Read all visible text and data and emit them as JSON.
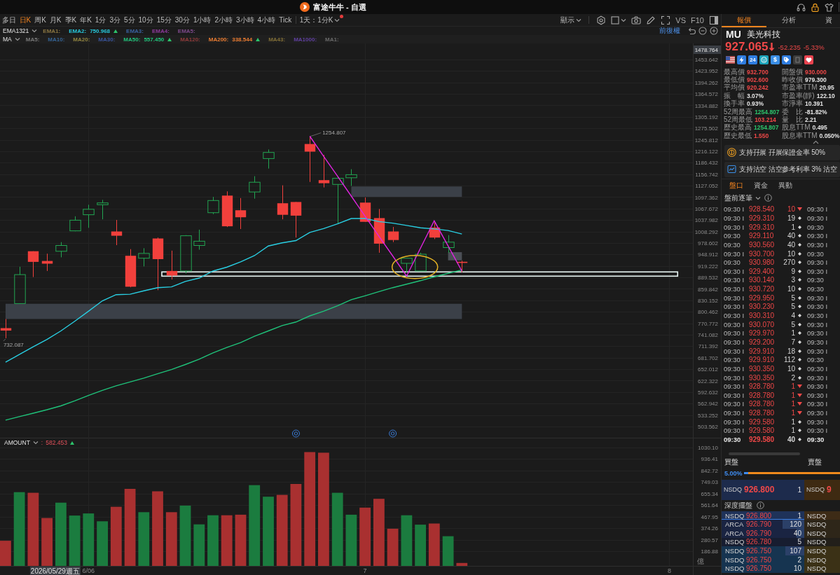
{
  "window": {
    "title": "富途牛牛 - 自選"
  },
  "toolbar": {
    "periods": [
      {
        "label": "多日",
        "selected": false
      },
      {
        "label": "日K",
        "selected": true
      },
      {
        "label": "周K",
        "selected": false
      },
      {
        "label": "月K",
        "selected": false
      },
      {
        "label": "季K",
        "selected": false
      },
      {
        "label": "年K",
        "selected": false
      },
      {
        "label": "1分",
        "selected": false
      },
      {
        "label": "3分",
        "selected": false
      },
      {
        "label": "5分",
        "selected": false
      },
      {
        "label": "10分",
        "selected": false
      },
      {
        "label": "15分",
        "selected": false
      },
      {
        "label": "30分",
        "selected": false
      },
      {
        "label": "1小時",
        "selected": false
      },
      {
        "label": "2小時",
        "selected": false
      },
      {
        "label": "3小時",
        "selected": false
      },
      {
        "label": "4小時",
        "selected": false
      },
      {
        "label": "Tick",
        "selected": false
      }
    ],
    "range": {
      "label": "1天：1分K",
      "alert": true
    },
    "display": "顯示",
    "buttons": [
      "VS",
      "F10"
    ]
  },
  "legend": {
    "rows": [
      {
        "label": "EMA1321",
        "items": [
          {
            "label": "EMA1:",
            "color": "#8a7642",
            "rising": false
          },
          {
            "label": "EMA2:",
            "color": "#27c8dc",
            "value": "750.968",
            "rising": true
          },
          {
            "label": "EMA3:",
            "color": "#3a62a0",
            "rising": false
          },
          {
            "label": "EMA4:",
            "color": "#8e3a9c",
            "rising": false
          },
          {
            "label": "EMA5:",
            "color": "#7e4a8c",
            "rising": false
          }
        ]
      },
      {
        "label": "MA",
        "items": [
          {
            "label": "MA5:",
            "color": "#7a7a7a",
            "rising": false
          },
          {
            "label": "MA10:",
            "color": "#356496",
            "rising": false
          },
          {
            "label": "MA20:",
            "color": "#918540",
            "rising": false
          },
          {
            "label": "MA30:",
            "color": "#3a56a0",
            "rising": false
          },
          {
            "label": "MA50:",
            "color": "#22c47c",
            "value": "557.450",
            "rising": true
          },
          {
            "label": "MA120:",
            "color": "#923c3c",
            "rising": false
          },
          {
            "label": "MA200:",
            "color": "#ec7d32",
            "value": "338.544",
            "rising": true
          },
          {
            "label": "MA43:",
            "color": "#837038",
            "rising": false
          },
          {
            "label": "MA1000:",
            "color": "#6040a0",
            "rising": false
          },
          {
            "label": "MA1:",
            "color": "#6a6a6a",
            "rising": false
          }
        ]
      }
    ],
    "adjustment": "前復權"
  },
  "chart": {
    "crosshair_price": "1478.764",
    "crosshair_date": "2026/05/29週五",
    "volume_header": {
      "label": "AMOUNT",
      "separator": ":",
      "value": "582.453",
      "rising": true
    },
    "chart_data": [
      {
        "type": "candlestick",
        "ylim": [
          474.5,
          1495.34
        ],
        "yticks": [
          1453.642,
          1423.952,
          1394.262,
          1364.572,
          1334.882,
          1305.192,
          1275.502,
          1245.812,
          1216.122,
          1186.432,
          1156.742,
          1127.052,
          1097.362,
          1067.672,
          1037.982,
          1008.292,
          978.602,
          948.912,
          919.222,
          889.532,
          859.842,
          830.152,
          800.462,
          770.772,
          741.082,
          711.392,
          681.702,
          652.012,
          622.322,
          592.632,
          562.942,
          533.252,
          503.562
        ],
        "tick_labels": "y",
        "grid": true,
        "ohlc": [
          [
            758.3,
            781.9,
            732.087,
            752.0
          ],
          [
            822.0,
            917.2,
            821.0,
            896.8
          ],
          [
            957.3,
            957.3,
            890.5,
            929.8
          ],
          [
            932.2,
            951.0,
            906.2,
            925.1
          ],
          [
            957.3,
            980.9,
            941.6,
            972.3
          ],
          [
            1010.0,
            1047.8,
            1009.0,
            1037.6
          ],
          [
            1051.7,
            1077.7,
            1017.9,
            1065.9
          ],
          [
            1077.7,
            1090.3,
            1039.9,
            1082.4
          ],
          [
            1008.5,
            1038.4,
            973.1,
            997.4
          ],
          [
            945.5,
            962.8,
            864.0,
            865.3
          ],
          [
            939.2,
            965.2,
            918.0,
            951.8
          ],
          [
            990.4,
            992.7,
            856.6,
            936.9
          ],
          [
            906.2,
            958.9,
            884.2,
            894.4
          ],
          [
            906.2,
            999.0,
            899.9,
            997.4
          ],
          [
            972.3,
            1013.2,
            961.3,
            983.3
          ],
          [
            1057.2,
            1098.1,
            1053.3,
            1088.7
          ],
          [
            1101.3,
            1112.3,
            1020.0,
            1021.8
          ],
          [
            1063.5,
            1095.0,
            1014.8,
            1045.4
          ],
          [
            1110.7,
            1151.6,
            1093.4,
            1135.9
          ],
          [
            1197.2,
            1220.8,
            1171.3,
            1213.0
          ],
          [
            1081.6,
            1128.0,
            1039.9,
            1051.7
          ],
          [
            1084.8,
            1084.8,
            992.7,
            1049.4
          ],
          [
            1235.0,
            1254.807,
            1136.7,
            1215.3
          ],
          [
            1141.4,
            1206.7,
            1122.5,
            1133.5
          ],
          [
            1130.4,
            1150.0,
            1028.1,
            1146.1
          ],
          [
            1147.7,
            1169.7,
            1126.5,
            1155.6
          ],
          [
            1083.2,
            1096.6,
            1033.6,
            1033.6
          ],
          [
            1043.1,
            1066.7,
            953.4,
            977.0
          ],
          [
            1008.5,
            1020.3,
            980.9,
            986.4
          ],
          [
            925.9,
            939.2,
            902.3,
            939.2
          ],
          [
            906.2,
            953.4,
            906.2,
            949.5
          ],
          [
            1018.7,
            1032.1,
            988.8,
            992.7
          ],
          [
            966.8,
            999.0,
            953.4,
            980.9
          ],
          [
            930.0,
            932.7,
            902.6,
            927.065
          ]
        ],
        "series": [
          {
            "type": "line",
            "color": "#29cfe3",
            "values": [
              670,
              690,
              710,
              729,
              751,
              776,
              802,
              829,
              845,
              846,
              855,
              863,
              865,
              879,
              888,
              906,
              916,
              930,
              946,
              971,
              979,
              985,
              1006,
              1016,
              1028,
              1042,
              1042,
              1034,
              1030,
              1024,
              1018,
              1015,
              1011,
              1002
            ]
          },
          {
            "type": "line",
            "color": "#1fc27a",
            "values": [
              520,
              529,
              538,
              547,
              557,
              570,
              584,
              597,
              609,
              619,
              629,
              640,
              651,
              664,
              678,
              694,
              708,
              721,
              737,
              751,
              765,
              774,
              790,
              802,
              816,
              832,
              842,
              853,
              863,
              872,
              881,
              891,
              900,
              909
            ]
          },
          {
            "type": "line",
            "color": "#e024e0",
            "values": [
              null,
              null,
              null,
              null,
              null,
              null,
              null,
              null,
              null,
              null,
              null,
              null,
              null,
              null,
              null,
              null,
              null,
              null,
              null,
              null,
              null,
              null,
              1255,
              1203,
              1152,
              1100,
              1048,
              996,
              945,
              893,
              965,
              1036,
              971,
              906
            ]
          }
        ],
        "annotations": [
          "1254.807",
          "732.087"
        ]
      },
      {
        "type": "bar",
        "ylim": [
          67.25,
          1109.86
        ],
        "yticks": [
          {
            "value": 1030.1,
            "label": "1030.10"
          },
          {
            "value": 936.41,
            "label": "936.41"
          },
          {
            "value": 842.72,
            "label": "842.72"
          },
          {
            "value": 749.03,
            "label": "749.03"
          },
          {
            "value": 655.34,
            "label": "655.34"
          },
          {
            "value": 561.64,
            "label": "561.64"
          },
          {
            "value": 467.95,
            "label": "467.95"
          },
          {
            "value": 374.26,
            "label": "374.26"
          },
          {
            "value": 280.57,
            "label": "280.57"
          },
          {
            "value": 186.88,
            "label": "186.88"
          }
        ],
        "ylabel": "億",
        "grid": true,
        "categories": [
          null,
          null,
          null,
          null,
          null,
          null,
          "6/06",
          null,
          null,
          null,
          null,
          null,
          null,
          null,
          null,
          null,
          null,
          null,
          null,
          null,
          null,
          null,
          null,
          null,
          null,
          null,
          "7",
          null,
          null,
          null,
          null,
          null,
          null,
          null,
          null,
          null,
          null,
          null,
          null,
          null,
          null,
          null,
          null,
          null,
          null,
          null,
          null,
          null,
          "8"
        ],
        "values": [
          272,
          667,
          662,
          457,
          582,
          477,
          494,
          430,
          548,
          694,
          504,
          674,
          504,
          558,
          405,
          479,
          479,
          484,
          724,
          630,
          645,
          734,
          993,
          988,
          662,
          484,
          541,
          613,
          370,
          479,
          403,
          412,
          309,
          91,
          null,
          null,
          null,
          null,
          null,
          null,
          null,
          null,
          null,
          null,
          null,
          null,
          null,
          null,
          null
        ],
        "colors": [
          "#a93030",
          "#1b7c3f",
          "#a93030",
          "#a93030",
          "#1b7c3f",
          "#1b7c3f",
          "#1b7c3f",
          "#1b7c3f",
          "#a93030",
          "#a93030",
          "#1b7c3f",
          "#a93030",
          "#a93030",
          "#1b7c3f",
          "#1b7c3f",
          "#1b7c3f",
          "#a93030",
          "#a93030",
          "#1b7c3f",
          "#1b7c3f",
          "#a93030",
          "#a93030",
          "#a93030",
          "#a93030",
          "#1b7c3f",
          "#1b7c3f",
          "#a93030",
          "#a93030",
          "#a93030",
          "#1b7c3f",
          "#1b7c3f",
          "#a93030",
          "#1b7c3f",
          "#a93030",
          null,
          null,
          null,
          null,
          null,
          null,
          null,
          null,
          null,
          null,
          null,
          null,
          null,
          null,
          null
        ]
      }
    ]
  },
  "quote": {
    "tabs": [
      {
        "label": "報價",
        "selected": true
      },
      {
        "label": "分析",
        "selected": false
      },
      {
        "label": "資",
        "selected": false
      }
    ],
    "symbol": "MU",
    "name": "美光科技",
    "price": "927.065",
    "falling": true,
    "change": "-52.235",
    "change_pct": "-5.33%",
    "badges": [
      {
        "kind": "flag"
      },
      {
        "kind": "lightning"
      },
      {
        "kind": "number",
        "label": "24"
      },
      {
        "kind": "face"
      },
      {
        "kind": "currency",
        "label": "$"
      },
      {
        "kind": "tag"
      },
      {
        "kind": "square"
      },
      {
        "kind": "heart"
      }
    ],
    "stats": [
      {
        "label": "最高價",
        "value": "932.700",
        "color": "#f04848"
      },
      {
        "label": "開盤價",
        "value": "930.000",
        "color": "#f04848"
      },
      {
        "label": "最低價",
        "value": "902.600",
        "color": "#f04848"
      },
      {
        "label": "昨收價",
        "value": "979.300",
        "color": "#e6e6e6"
      },
      {
        "label": "平均價",
        "value": "920.242",
        "color": "#f04848"
      },
      {
        "label": "市盈率TTM",
        "value": "20.95",
        "color": "#e6e6e6"
      },
      {
        "label": "振　幅",
        "value": "3.07%",
        "color": "#e6e6e6"
      },
      {
        "label": "市盈率(靜)",
        "value": "122.10",
        "color": "#e6e6e6"
      },
      {
        "label": "換手率",
        "value": "0.93%",
        "color": "#e6e6e6"
      },
      {
        "label": "市淨率",
        "value": "10.391",
        "color": "#e6e6e6"
      },
      {
        "label": "52周最高",
        "value": "1254.807",
        "color": "#2cc46b"
      },
      {
        "label": "委　比",
        "value": "-81.82%",
        "color": "#e6e6e6"
      },
      {
        "label": "52周最低",
        "value": "103.214",
        "color": "#f04848"
      },
      {
        "label": "量　比",
        "value": "2.21",
        "color": "#e6e6e6"
      },
      {
        "label": "歷史最高",
        "value": "1254.807",
        "color": "#2cc46b"
      },
      {
        "label": "股息TTM",
        "value": "0.495",
        "color": "#e6e6e6"
      },
      {
        "label": "歷史最低",
        "value": "1.550",
        "color": "#f04848"
      },
      {
        "label": "股息率TTM",
        "value": "0.050%",
        "color": "#e6e6e6"
      }
    ],
    "features": [
      {
        "kind": "margin",
        "text": "支持孖展 孖展保證金率 50%"
      },
      {
        "kind": "short",
        "text": "支持沽空 沽空參考利率 3% 沽空"
      }
    ],
    "sub_tabs": [
      {
        "label": "盤口",
        "selected": true
      },
      {
        "label": "資金",
        "selected": false
      },
      {
        "label": "異動",
        "selected": false
      }
    ],
    "trades": {
      "title": "盤前逐筆",
      "rows": [
        {
          "time": "09:30 I",
          "price": "928.540",
          "qty": "10",
          "kind": "sell",
          "time_2": "09:30 I",
          "latest": false
        },
        {
          "time": "09:30 I",
          "price": "929.310",
          "qty": "19",
          "kind": "neutral",
          "time_2": "09:30 I",
          "latest": false
        },
        {
          "time": "09:30 I",
          "price": "929.310",
          "qty": "1",
          "kind": "neutral",
          "time_2": "09:30",
          "latest": false
        },
        {
          "time": "09:30",
          "price": "929.110",
          "qty": "40",
          "kind": "neutral",
          "time_2": "09:30 I",
          "latest": false
        },
        {
          "time": "09:30",
          "price": "930.560",
          "qty": "40",
          "kind": "neutral",
          "time_2": "09:30 I",
          "latest": false
        },
        {
          "time": "09:30 I",
          "price": "930.700",
          "qty": "10",
          "kind": "neutral",
          "time_2": "09:30",
          "latest": false
        },
        {
          "time": "09:30",
          "price": "930.980",
          "qty": "270",
          "kind": "neutral",
          "time_2": "09:30 I",
          "latest": false
        },
        {
          "time": "09:30 I",
          "price": "929.400",
          "qty": "9",
          "kind": "neutral",
          "time_2": "09:30 I",
          "latest": false
        },
        {
          "time": "09:30 I",
          "price": "930.140",
          "qty": "3",
          "kind": "neutral",
          "time_2": "09:30",
          "latest": false
        },
        {
          "time": "09:30 I",
          "price": "930.720",
          "qty": "10",
          "kind": "neutral",
          "time_2": "09:30",
          "latest": false
        },
        {
          "time": "09:30 I",
          "price": "929.950",
          "qty": "5",
          "kind": "neutral",
          "time_2": "09:30 I",
          "latest": false
        },
        {
          "time": "09:30 I",
          "price": "930.230",
          "qty": "5",
          "kind": "neutral",
          "time_2": "09:30 I",
          "latest": false
        },
        {
          "time": "09:30 I",
          "price": "930.310",
          "qty": "4",
          "kind": "neutral",
          "time_2": "09:30 I",
          "latest": false
        },
        {
          "time": "09:30 I",
          "price": "930.070",
          "qty": "5",
          "kind": "neutral",
          "time_2": "09:30 I",
          "latest": false
        },
        {
          "time": "09:30 I",
          "price": "929.970",
          "qty": "1",
          "kind": "neutral",
          "time_2": "09:30 I",
          "latest": false
        },
        {
          "time": "09:30 I",
          "price": "929.200",
          "qty": "7",
          "kind": "neutral",
          "time_2": "09:30 I",
          "latest": false
        },
        {
          "time": "09:30 I",
          "price": "929.910",
          "qty": "18",
          "kind": "neutral",
          "time_2": "09:30 I",
          "latest": false
        },
        {
          "time": "09:30",
          "price": "929.910",
          "qty": "112",
          "kind": "neutral",
          "time_2": "09:30",
          "latest": false
        },
        {
          "time": "09:30 I",
          "price": "930.350",
          "qty": "10",
          "kind": "neutral",
          "time_2": "09:30 I",
          "latest": false
        },
        {
          "time": "09:30 I",
          "price": "930.350",
          "qty": "2",
          "kind": "neutral",
          "time_2": "09:30 I",
          "latest": false
        },
        {
          "time": "09:30 I",
          "price": "928.780",
          "qty": "1",
          "kind": "sell",
          "time_2": "09:30 I",
          "latest": false
        },
        {
          "time": "09:30 I",
          "price": "928.780",
          "qty": "1",
          "kind": "sell",
          "time_2": "09:30 I",
          "latest": false
        },
        {
          "time": "09:30 I",
          "price": "928.780",
          "qty": "1",
          "kind": "sell",
          "time_2": "09:30 I",
          "latest": false
        },
        {
          "time": "09:30 I",
          "price": "928.780",
          "qty": "1",
          "kind": "sell",
          "time_2": "09:30 I",
          "latest": false
        },
        {
          "time": "09:30 I",
          "price": "929.580",
          "qty": "1",
          "kind": "neutral",
          "time_2": "09:30 I",
          "latest": false
        },
        {
          "time": "09:30 I",
          "price": "929.580",
          "qty": "1",
          "kind": "neutral",
          "time_2": "09:30 I",
          "latest": false
        },
        {
          "time": "09:30",
          "price": "929.580",
          "qty": "40",
          "kind": "neutral",
          "time_2": "09:30",
          "latest": true
        }
      ]
    },
    "order_book": {
      "bid_label": "買盤",
      "ask_label": "賣盤",
      "bid_ratio": "5.00%",
      "level": 0.05,
      "best_bid": {
        "exchange": "NSDQ",
        "price": "926.800",
        "qty": "1"
      },
      "best_ask": {
        "exchange": "NSDQ",
        "price": "9"
      },
      "depth_title": "深度擺盤",
      "depth": [
        {
          "exchange": "NSDQ",
          "price": "926.800",
          "qty": "1",
          "color": "#1f3259",
          "selected": true,
          "ask": {
            "exchange": "NSDQ",
            "color": "#3d2b16"
          }
        },
        {
          "exchange": "ARCA",
          "price": "926.790",
          "qty": "120",
          "level": 0.26,
          "color": "#1a2442",
          "selected": false,
          "ask": {
            "exchange": "NSDQ",
            "color": "#2e2619"
          }
        },
        {
          "exchange": "ARCA",
          "price": "926.790",
          "qty": "40",
          "level": 0.09,
          "color": "#1a2442",
          "selected": false,
          "ask": {
            "exchange": "NSDQ",
            "color": "#2e2619"
          }
        },
        {
          "exchange": "NSDQ",
          "price": "926.780",
          "qty": "5",
          "color": "#171d30",
          "selected": false,
          "ask": {
            "exchange": "NSDQ",
            "color": "#221f1a"
          }
        },
        {
          "exchange": "NSDQ",
          "price": "926.750",
          "qty": "107",
          "level": 0.23,
          "color": "#163450",
          "selected": false,
          "ask": {
            "exchange": "NSDQ",
            "color": "#3b3116"
          }
        },
        {
          "exchange": "NSDQ",
          "price": "926.750",
          "qty": "2",
          "color": "#163450",
          "selected": false,
          "ask": {
            "exchange": "NSDQ",
            "color": "#3b3116"
          }
        },
        {
          "exchange": "NSDQ",
          "price": "926.750",
          "qty": "10",
          "color": "#163450",
          "selected": false,
          "ask": {
            "exchange": "NSDQ",
            "color": "#3b3116"
          }
        }
      ]
    }
  }
}
